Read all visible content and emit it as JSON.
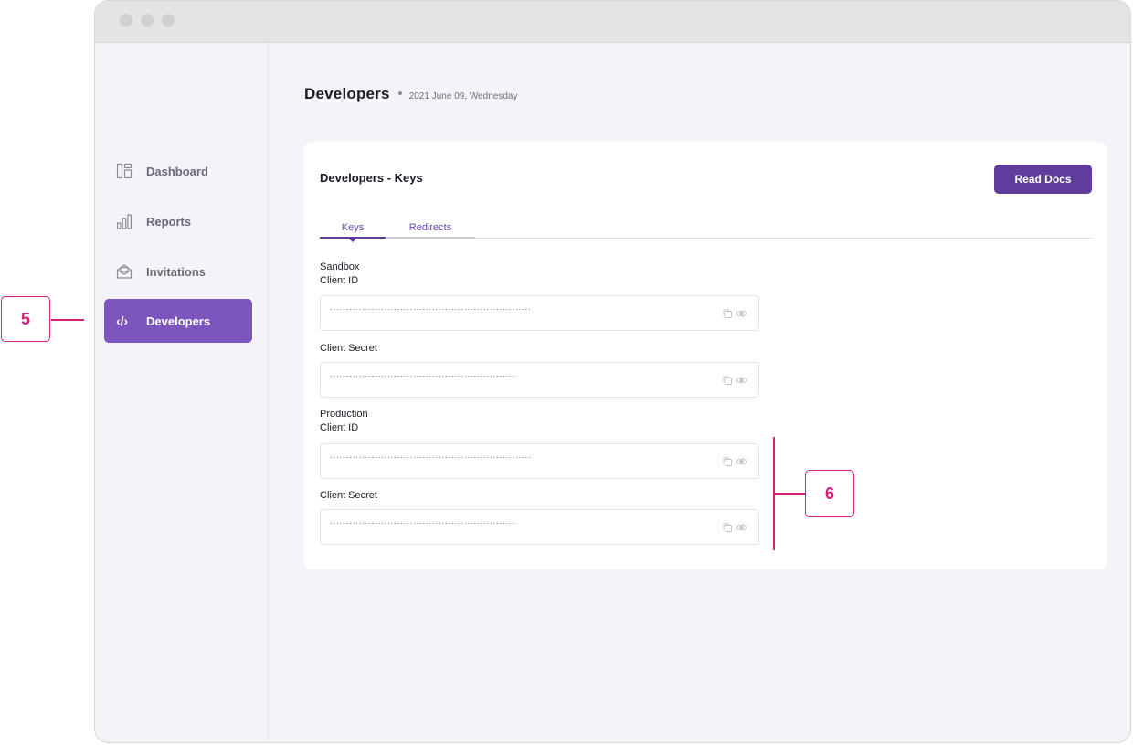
{
  "sidebar": {
    "items": [
      {
        "label": "Dashboard",
        "icon": "dashboard-icon"
      },
      {
        "label": "Reports",
        "icon": "reports-icon"
      },
      {
        "label": "Invitations",
        "icon": "invitations-icon"
      },
      {
        "label": "Developers",
        "icon": "code-icon",
        "glyph": "‹/›",
        "active": true
      }
    ]
  },
  "header": {
    "title": "Developers",
    "date": "2021 June 09, Wednesday"
  },
  "card": {
    "title": "Developers - Keys",
    "docs_button": "Read Docs",
    "tabs": [
      {
        "label": "Keys",
        "active": true
      },
      {
        "label": "Redirects"
      }
    ],
    "sandbox": {
      "section_label": "Sandbox",
      "client_id_label": "Client ID",
      "client_id_value": "·······························································",
      "client_secret_label": "Client Secret",
      "client_secret_value": "··························································"
    },
    "production": {
      "section_label": "Production",
      "client_id_label": "Client ID",
      "client_id_value": "·······························································",
      "client_secret_label": "Client Secret",
      "client_secret_value": "··························································"
    }
  },
  "callouts": {
    "nav": "5",
    "production": "6"
  },
  "colors": {
    "accent": "#7c55bf",
    "button": "#5f3d9c",
    "callout": "#d61e7a"
  }
}
